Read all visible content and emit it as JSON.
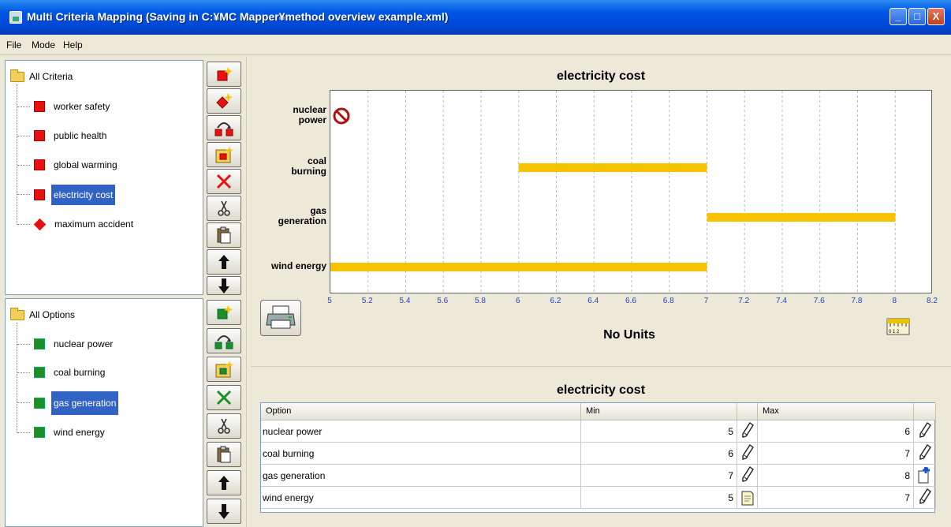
{
  "window": {
    "title": "Multi Criteria Mapping (Saving in C:¥MC Mapper¥method overview example.xml)",
    "controls": [
      "_",
      "□",
      "X"
    ]
  },
  "menu": [
    "File",
    "Mode",
    "Help"
  ],
  "criteria": {
    "root_label": "All Criteria",
    "items": [
      {
        "label": "worker safety",
        "icon": "red-square-icon"
      },
      {
        "label": "public health",
        "icon": "red-square-icon"
      },
      {
        "label": "global warming",
        "icon": "red-square-icon"
      },
      {
        "label": "electricity cost",
        "icon": "red-square-icon",
        "selected": true
      },
      {
        "label": "maximum accident",
        "icon": "red-diamond-icon"
      }
    ]
  },
  "options": {
    "root_label": "All Options",
    "items": [
      {
        "label": "nuclear power",
        "icon": "green-square-icon"
      },
      {
        "label": "coal burning",
        "icon": "green-square-icon"
      },
      {
        "label": "gas generation",
        "icon": "green-square-icon",
        "selected": true
      },
      {
        "label": "wind energy",
        "icon": "green-square-icon"
      }
    ]
  },
  "chart": {
    "units_label": "No Units"
  },
  "chart_data": {
    "type": "bar",
    "title": "electricity cost",
    "xlabel": "No Units",
    "xlim": [
      5,
      8.2
    ],
    "xticks": [
      "5",
      "5.2",
      "5.4",
      "5.6",
      "5.8",
      "6",
      "6.2",
      "6.4",
      "6.6",
      "6.8",
      "7",
      "7.2",
      "7.4",
      "7.6",
      "7.8",
      "8",
      "8.2"
    ],
    "grid": true,
    "categories": [
      "nuclear power",
      "coal burning",
      "gas generation",
      "wind energy"
    ],
    "category_display": [
      [
        "nuclear",
        "power"
      ],
      [
        "coal",
        "burning"
      ],
      [
        "gas",
        "generation"
      ],
      [
        "wind energy"
      ]
    ],
    "ranges": [
      null,
      [
        6,
        7
      ],
      [
        7,
        8
      ],
      [
        5,
        7
      ]
    ],
    "excluded": [
      "nuclear power"
    ],
    "bar_color": "#f7c200"
  },
  "table": {
    "title": "electricity cost",
    "headers": [
      "Option",
      "Min",
      "Max"
    ],
    "rows": [
      {
        "option": "nuclear power",
        "min": "5",
        "max": "6",
        "min_icon": "pencil-icon",
        "max_icon": "pencil-icon"
      },
      {
        "option": "coal burning",
        "min": "6",
        "max": "7",
        "min_icon": "pencil-icon",
        "max_icon": "pencil-icon"
      },
      {
        "option": "gas generation",
        "min": "7",
        "max": "8",
        "min_icon": "pencil-icon",
        "max_icon": "note-plus-icon"
      },
      {
        "option": "wind energy",
        "min": "5",
        "max": "7",
        "min_icon": "note-icon",
        "max_icon": "pencil-icon"
      }
    ]
  },
  "colors": {
    "titlebar": "#0055e5",
    "criteria_marker": "#e81010",
    "option_marker": "#1e8f28",
    "selection": "#3163c5",
    "tick_label": "#2840c0"
  }
}
